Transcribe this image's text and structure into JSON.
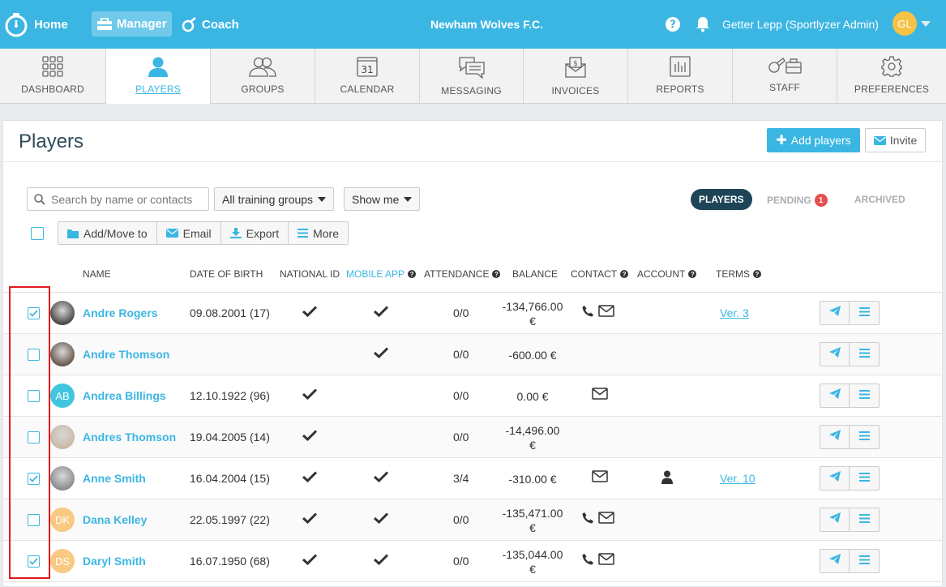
{
  "topbar": {
    "home_label": "Home",
    "manager_label": "Manager",
    "coach_label": "Coach",
    "club_name": "Newham Wolves F.C.",
    "user_name": "Getter Lepp (Sportlyzer Admin)",
    "user_initials": "GL",
    "bg_color": "#3bb6e3"
  },
  "nav": {
    "tabs": [
      {
        "label": "DASHBOARD",
        "icon": "grid-icon"
      },
      {
        "label": "PLAYERS",
        "icon": "user-icon",
        "active": true
      },
      {
        "label": "GROUPS",
        "icon": "users-icon"
      },
      {
        "label": "CALENDAR",
        "icon": "calendar-icon",
        "day": "31"
      },
      {
        "label": "MESSAGING",
        "icon": "chat-icon"
      },
      {
        "label": "INVOICES",
        "icon": "invoice-icon"
      },
      {
        "label": "REPORTS",
        "icon": "bar-chart-icon"
      },
      {
        "label": "STAFF",
        "icon": "whistle-icon"
      },
      {
        "label": "PREFERENCES",
        "icon": "gear-icon"
      }
    ]
  },
  "page": {
    "title": "Players",
    "add_players_label": "Add players",
    "invite_label": "Invite"
  },
  "filters": {
    "search_placeholder": "Search by name or contacts",
    "groups_label": "All training groups",
    "show_me_label": "Show me",
    "players_label": "PLAYERS",
    "pending_label": "PENDING",
    "pending_count": "1",
    "archived_label": "ARCHIVED"
  },
  "actions": {
    "add_move_label": "Add/Move to",
    "email_label": "Email",
    "export_label": "Export",
    "more_label": "More"
  },
  "columns": {
    "name": "NAME",
    "dob": "DATE OF BIRTH",
    "national_id": "NATIONAL ID",
    "mobile_app": "MOBILE APP",
    "attendance": "ATTENDANCE",
    "balance": "BALANCE",
    "contact": "CONTACT",
    "account": "ACCOUNT",
    "terms": "TERMS"
  },
  "players": [
    {
      "name": "Andre Rogers",
      "dob": "09.08.2001 (17)",
      "national_id": true,
      "mobile_app": true,
      "attendance": "0/0",
      "balance_line1": "-134,766.00",
      "balance_line2": "€",
      "phone": true,
      "email": true,
      "account": false,
      "terms": "Ver. 3",
      "checked": true,
      "avatar_type": "photo",
      "avatar_color": "#4a4a4a"
    },
    {
      "name": "Andre Thomson",
      "dob": "",
      "national_id": false,
      "mobile_app": true,
      "attendance": "0/0",
      "balance_line1": "-600.00 €",
      "balance_line2": "",
      "phone": false,
      "email": false,
      "account": false,
      "terms": "",
      "checked": false,
      "avatar_type": "photo",
      "avatar_color": "#6b5a50"
    },
    {
      "name": "Andrea Billings",
      "dob": "12.10.1922 (96)",
      "national_id": true,
      "mobile_app": false,
      "attendance": "0/0",
      "balance_line1": "0.00 €",
      "balance_line2": "",
      "phone": false,
      "email": true,
      "account": false,
      "terms": "",
      "checked": false,
      "avatar_type": "initials",
      "initials": "AB",
      "avatar_color": "#42c6e0"
    },
    {
      "name": "Andres Thomson",
      "dob": "19.04.2005 (14)",
      "national_id": true,
      "mobile_app": false,
      "attendance": "0/0",
      "balance_line1": "-14,496.00",
      "balance_line2": "€",
      "phone": false,
      "email": false,
      "account": false,
      "terms": "",
      "checked": false,
      "avatar_type": "photo",
      "avatar_color": "#c9b9a5"
    },
    {
      "name": "Anne Smith",
      "dob": "16.04.2004 (15)",
      "national_id": true,
      "mobile_app": true,
      "attendance": "3/4",
      "balance_line1": "-310.00 €",
      "balance_line2": "",
      "phone": false,
      "email": true,
      "account": true,
      "terms": "Ver. 10",
      "checked": true,
      "avatar_type": "photo",
      "avatar_color": "#8a8e91"
    },
    {
      "name": "Dana Kelley",
      "dob": "22.05.1997 (22)",
      "national_id": true,
      "mobile_app": true,
      "attendance": "0/0",
      "balance_line1": "-135,471.00",
      "balance_line2": "€",
      "phone": true,
      "email": true,
      "account": false,
      "terms": "",
      "checked": false,
      "avatar_type": "initials",
      "initials": "DK",
      "avatar_color": "#f9c981"
    },
    {
      "name": "Daryl Smith",
      "dob": "16.07.1950 (68)",
      "national_id": true,
      "mobile_app": true,
      "attendance": "0/0",
      "balance_line1": "-135,044.00",
      "balance_line2": "€",
      "phone": true,
      "email": true,
      "account": false,
      "terms": "",
      "checked": true,
      "avatar_type": "initials",
      "initials": "DS",
      "avatar_color": "#f9c981"
    }
  ]
}
